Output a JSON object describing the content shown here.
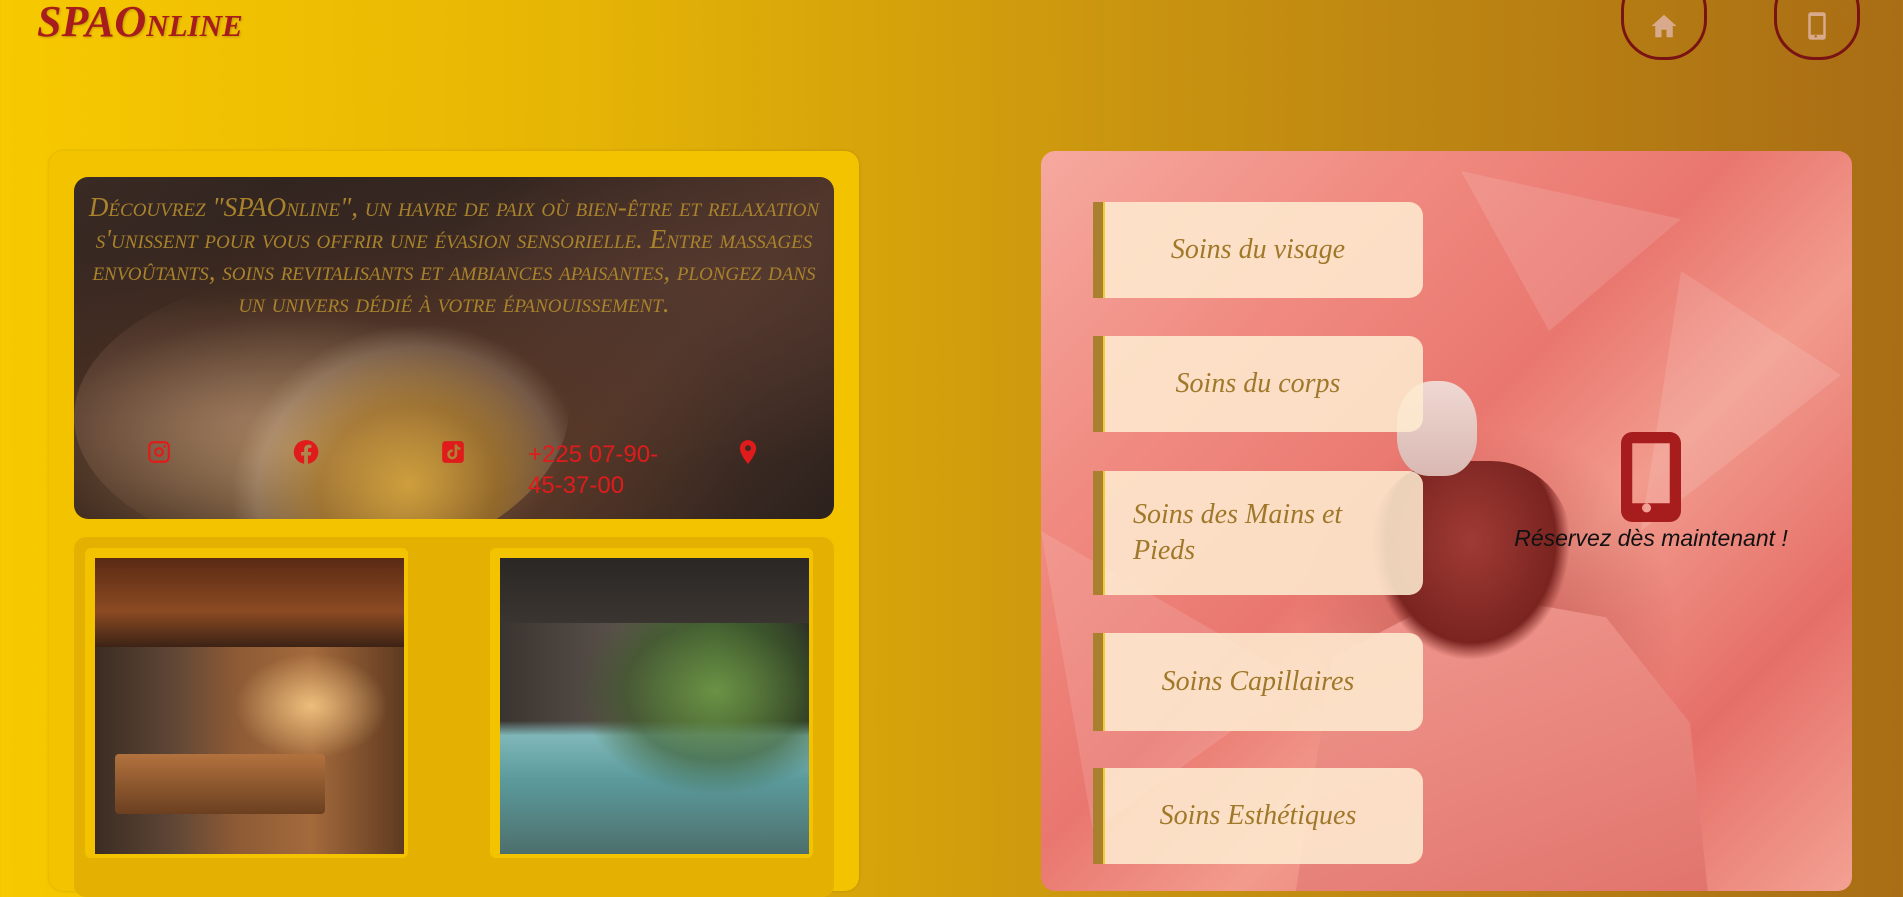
{
  "header": {
    "logo": "SPAOnline",
    "home_icon": "home-icon",
    "phone_icon": "phone-icon"
  },
  "hero": {
    "description": "Découvrez \"SPAOnline\", un havre de paix où bien-être et relaxation s'unissent pour vous offrir une évasion sensorielle. Entre massages envoûtants, soins revitalisants et ambiances apaisantes, plongez dans un univers dédié à votre épanouissement.",
    "phone": "+225 07-90-45-37-00",
    "icons": [
      "instagram-icon",
      "facebook-icon",
      "tiktok-icon",
      "map-pin-icon"
    ]
  },
  "menu": {
    "items": [
      "Soins du visage",
      "Soins du corps",
      "Soins des Mains et Pieds",
      "Soins Capillaires",
      "Soins Esthétiques"
    ]
  },
  "reserve": {
    "text": "Réservez dès maintenant !"
  },
  "colors": {
    "brand": "#a71c1c",
    "gold": "#f4c300",
    "accent_text": "#a0782a",
    "contact_red": "#e01b1b"
  }
}
